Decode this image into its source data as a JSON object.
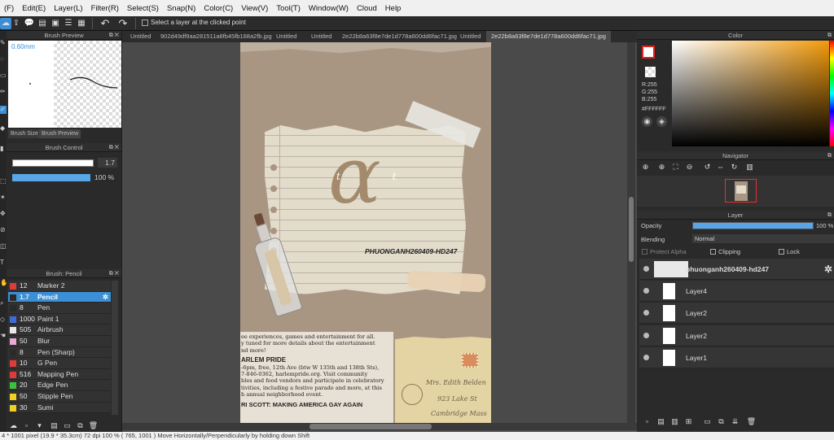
{
  "menu": [
    "(F)",
    "Edit(E)",
    "Layer(L)",
    "Filter(R)",
    "Select(S)",
    "Snap(N)",
    "Color(C)",
    "View(V)",
    "Tool(T)",
    "Window(W)",
    "Cloud",
    "Help"
  ],
  "toolbar": {
    "select_layer_label": "Select a layer at the clicked point"
  },
  "brush_preview": {
    "title": "Brush Preview",
    "size_label": "0.60mm",
    "tabs": [
      "Brush Size",
      "Brush Preview"
    ]
  },
  "brush_control": {
    "title": "Brush Control",
    "size_value": "1.7",
    "opacity_value": "100 %"
  },
  "brush_list": {
    "title": "Brush: Pencil",
    "items": [
      {
        "size": "12",
        "name": "Marker 2",
        "color": "#e03b3b"
      },
      {
        "size": "1.7",
        "name": "Pencil",
        "color": "#2a2a2a",
        "selected": true
      },
      {
        "size": "8",
        "name": "Pen",
        "color": "#2a2a2a"
      },
      {
        "size": "1000",
        "name": "Paint 1",
        "color": "#3a6fd8"
      },
      {
        "size": "505",
        "name": "Airbrush",
        "color": "#e8e8e8"
      },
      {
        "size": "50",
        "name": "Blur",
        "color": "#e8a8d8"
      },
      {
        "size": "8",
        "name": "Pen (Sharp)",
        "color": "#2a2a2a"
      },
      {
        "size": "10",
        "name": "G Pen",
        "color": "#e03b3b"
      },
      {
        "size": "516",
        "name": "Mapping Pen",
        "color": "#e03b3b"
      },
      {
        "size": "20",
        "name": "Edge Pen",
        "color": "#3bc43b"
      },
      {
        "size": "50",
        "name": "Stipple Pen",
        "color": "#f0d020"
      },
      {
        "size": "30",
        "name": "Sumi",
        "color": "#f0d020"
      }
    ]
  },
  "tabs": [
    "Untitled",
    "902d49df9aa281511a8fb45fb168a2fb.jpg",
    "Untitled",
    "Untitled",
    "2e22b8a63f8e7de1d778a600dd6fac71.jpg",
    "Untitled",
    "2e22b8a63f8e7de1d778a600dd6fac71.jpg"
  ],
  "artwork": {
    "letter": "α",
    "small_letters": "t t",
    "signature": "PHUONGANH260409-HD247",
    "newspaper": {
      "lines_top": [
        "ee experiences, games and entertainment for all.",
        "y tuned for more details about the entertainment",
        "nd more!"
      ],
      "heading": "ARLEM PRIDE",
      "lines_body": [
        "-6pm, free, 12th Ave (btw W 135th and 138th Sts),",
        "7-846-0362, harlempride.org. Visit community",
        "bles and food vendors and participate in celebratory",
        "tivities, including a festive parade and more, at this",
        "h annual neighborhood event."
      ],
      "footer": "RI SCOTT: MAKING AMERICA GAY AGAIN"
    },
    "envelope_text": [
      "Mrs. Edith Belden",
      "923 Lake St",
      "Cambridge Mass"
    ]
  },
  "color_panel": {
    "title": "Color",
    "r": "R:255",
    "g": "G:255",
    "b": "B:255",
    "hex": "#FFFFFF"
  },
  "navigator": {
    "title": "Navigator"
  },
  "layer_panel": {
    "title": "Layer",
    "opacity_label": "Opacity",
    "opacity_value": "100 %",
    "opacity_fraction": 1.0,
    "blending_label": "Blending",
    "blending_value": "Normal",
    "protect_alpha": "Protect Alpha",
    "clipping": "Clipping",
    "lock": "Lock",
    "layers": [
      {
        "name": "phuonganh260409-hd247",
        "selected": true
      },
      {
        "name": "Layer4"
      },
      {
        "name": "Layer2"
      },
      {
        "name": "Layer2"
      },
      {
        "name": "Layer1"
      }
    ]
  },
  "status": "4 * 1001 pixel (19.9 * 35.3cm) 72 dpi 100 % ( 765, 1001 ) Move Horizontally/Perpendicularly by holding down Shift"
}
